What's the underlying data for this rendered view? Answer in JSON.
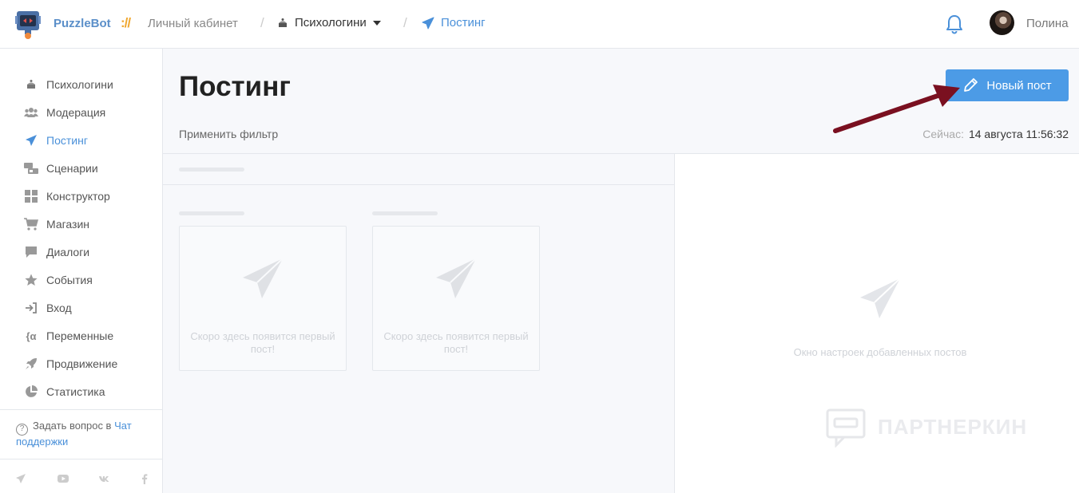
{
  "header": {
    "brand": "PuzzleBot",
    "brand_sep": "://",
    "crumb_cabinet": "Личный кабинет",
    "crumb_bot": "Психологини",
    "crumb_page": "Постинг",
    "username": "Полина"
  },
  "sidebar": {
    "items": [
      {
        "label": "Психологини",
        "icon": "cake-icon"
      },
      {
        "label": "Модерация",
        "icon": "users-icon"
      },
      {
        "label": "Постинг",
        "icon": "paper-plane-icon"
      },
      {
        "label": "Сценарии",
        "icon": "scenarios-icon"
      },
      {
        "label": "Конструктор",
        "icon": "grid-icon"
      },
      {
        "label": "Магазин",
        "icon": "cart-icon"
      },
      {
        "label": "Диалоги",
        "icon": "chat-icon"
      },
      {
        "label": "События",
        "icon": "star-icon"
      },
      {
        "label": "Вход",
        "icon": "sign-in-icon"
      },
      {
        "label": "Переменные",
        "icon": "variable-icon"
      },
      {
        "label": "Продвижение",
        "icon": "rocket-icon"
      },
      {
        "label": "Статистика",
        "icon": "pie-chart-icon"
      }
    ],
    "help_text": "Задать вопрос в",
    "help_link": "Чат поддержки"
  },
  "main": {
    "title": "Постинг",
    "new_post_label": "Новый пост",
    "filter_label": "Применить фильтр",
    "now_label": "Сейчас:",
    "now_value": "14 августа 11:56:32",
    "card_empty_text": "Скоро здесь появится первый пост!",
    "right_panel_text": "Окно настроек добавленных постов",
    "watermark": "ПАРТНЕРКИН"
  },
  "colors": {
    "accent": "#4a90d9",
    "button": "#4c9be6",
    "brand_sep": "#f0a830",
    "annotation_arrow": "#7a1020"
  }
}
